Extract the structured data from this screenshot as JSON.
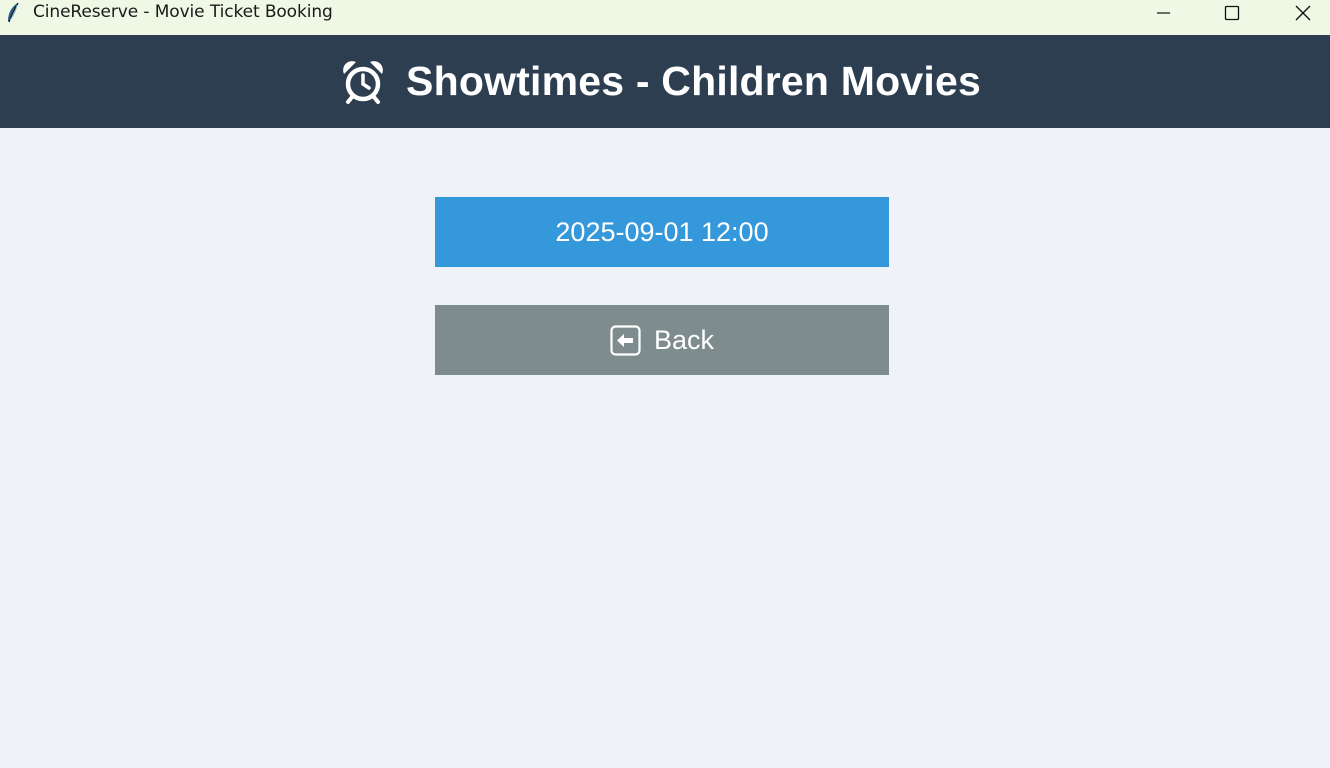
{
  "window": {
    "title": "CineReserve - Movie Ticket Booking",
    "icon": "feather-icon",
    "controls": {
      "minimize": "minimize-icon",
      "maximize": "maximize-icon",
      "close": "close-icon"
    }
  },
  "header": {
    "icon": "alarm-clock-icon",
    "title": "Showtimes - Children Movies",
    "background": "#2c3e50"
  },
  "showtimes": [
    {
      "label": "2025-09-01 12:00"
    }
  ],
  "back_button": {
    "icon": "back-arrow-icon",
    "label": "Back"
  },
  "colors": {
    "page_background": "#eff3f7",
    "titlebar_background": "#eef8e5",
    "showtime_button": "#3498db",
    "back_button": "#7f8c8d",
    "button_text": "#ffffff"
  }
}
